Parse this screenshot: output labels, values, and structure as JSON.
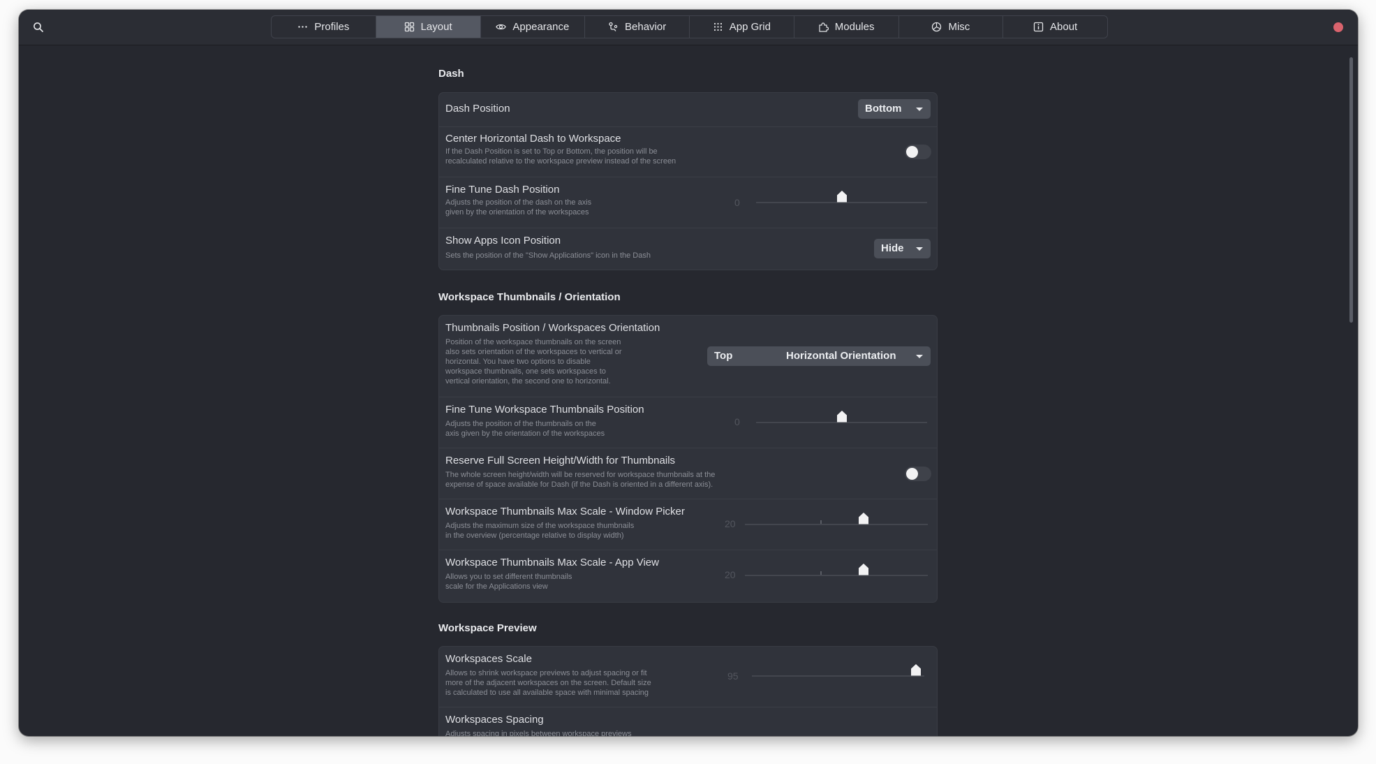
{
  "window": {
    "accent": "#545862",
    "close_color": "#d9636d"
  },
  "tabs": [
    {
      "label": "Profiles",
      "icon": "dots-icon"
    },
    {
      "label": "Layout",
      "icon": "grid-icon",
      "active": true
    },
    {
      "label": "Appearance",
      "icon": "eye-icon"
    },
    {
      "label": "Behavior",
      "icon": "behavior-icon"
    },
    {
      "label": "App Grid",
      "icon": "app-grid-icon"
    },
    {
      "label": "Modules",
      "icon": "puzzle-icon"
    },
    {
      "label": "Misc",
      "icon": "misc-icon"
    },
    {
      "label": "About",
      "icon": "info-icon"
    }
  ],
  "sections": {
    "dash": {
      "title": "Dash",
      "dash_position": {
        "title": "Dash Position",
        "value": "Bottom"
      },
      "center_horizontal": {
        "title": "Center Horizontal Dash to Workspace",
        "subtitle_1": "If the Dash Position is set to Top or Bottom, the position will be",
        "subtitle_2": "recalculated relative to the workspace preview instead of the screen",
        "enabled": false
      },
      "fine_tune": {
        "title": "Fine Tune Dash Position",
        "subtitle_1": "Adjusts the position of the dash on the axis",
        "subtitle_2": "given by the orientation of the workspaces",
        "value": "0",
        "level": 0.5
      },
      "show_apps": {
        "title": "Show Apps Icon Position",
        "subtitle_1": "Sets the position of the \"Show Applications\" icon in the Dash",
        "value": "Hide"
      }
    },
    "thumbnails": {
      "title": "Workspace Thumbnails / Orientation",
      "orientation": {
        "title": "Thumbnails Position / Workspaces Orientation",
        "subtitle_1": "Position of the workspace thumbnails on the screen",
        "subtitle_2": "also sets orientation of the workspaces to vertical or",
        "subtitle_3": "horizontal. You have two options to disable",
        "subtitle_4": "workspace thumbnails, one sets workspaces to",
        "subtitle_5": "vertical orientation, the second one to horizontal.",
        "value_position": "Top",
        "value_orientation": "Horizontal Orientation"
      },
      "fine_tune": {
        "title": "Fine Tune Workspace Thumbnails Position",
        "subtitle_1": "Adjusts the position of the thumbnails on the",
        "subtitle_2": "axis given by the orientation of the workspaces",
        "value": "0",
        "level": 0.5
      },
      "reserve": {
        "title": "Reserve Full Screen Height/Width for Thumbnails",
        "subtitle_1": "The whole screen height/width will be reserved for workspace thumbnails at the",
        "subtitle_2": "expense of space available for Dash (if the Dash is oriented in a different axis).",
        "enabled": false
      },
      "max_scale_picker": {
        "title": "Workspace Thumbnails Max Scale - Window Picker",
        "subtitle_1": "Adjusts the maximum size of the workspace thumbnails",
        "subtitle_2": "in the overview (percentage relative to display width)",
        "value": "20",
        "level": 0.65
      },
      "max_scale_app": {
        "title": "Workspace Thumbnails Max Scale - App View",
        "subtitle_1": "Allows you to set different thumbnails",
        "subtitle_2": "scale for the Applications view",
        "value": "20",
        "level": 0.65
      }
    },
    "preview": {
      "title": "Workspace Preview",
      "scale": {
        "title": "Workspaces Scale",
        "subtitle_1": "Allows to shrink workspace previews to adjust spacing or fit",
        "subtitle_2": "more of the adjacent workspaces on the screen. Default size",
        "subtitle_3": "is calculated to use all available space with minimal spacing",
        "value": "95",
        "level": 0.95
      },
      "spacing": {
        "title": "Workspaces Spacing",
        "subtitle_1": "Adjusts spacing in pixels between workspace previews"
      }
    }
  }
}
